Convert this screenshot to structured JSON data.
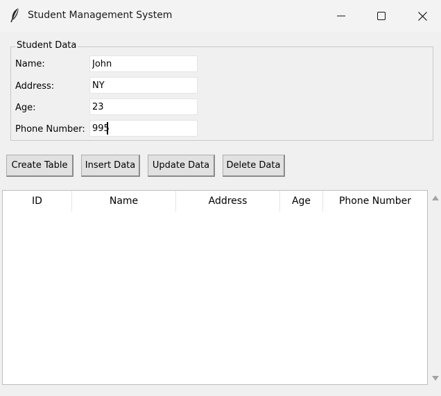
{
  "window": {
    "title": "Student Management System",
    "icon": "feather-icon",
    "controls": [
      "minimize-icon",
      "maximize-icon",
      "close-icon"
    ]
  },
  "student_data": {
    "frame_title": "Student Data",
    "fields": [
      {
        "label": "Name:",
        "value": "John"
      },
      {
        "label": "Address:",
        "value": "NY"
      },
      {
        "label": "Age:",
        "value": "23"
      },
      {
        "label": "Phone Number:",
        "value": "995"
      }
    ]
  },
  "buttons": {
    "create": "Create Table",
    "insert": "Insert Data",
    "update": "Update Data",
    "delete": "Delete Data"
  },
  "table": {
    "columns": [
      "ID",
      "Name",
      "Address",
      "Age",
      "Phone Number"
    ],
    "rows": []
  }
}
